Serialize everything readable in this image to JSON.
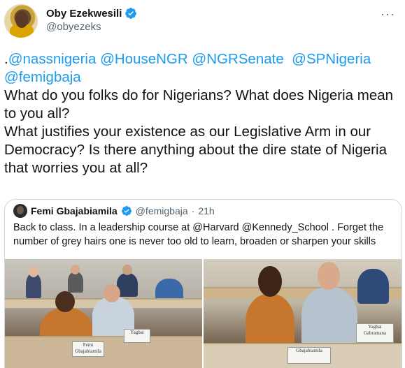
{
  "tweet": {
    "author_name": "Oby Ezekwesili",
    "author_handle": "@obyezeks",
    "more_icon": "···",
    "text_lines": [
      [
        ".",
        "@nassnigeria",
        " ",
        "@HouseNGR",
        " ",
        "@NGRSenate",
        "  ",
        "@SPNigeria"
      ],
      [
        "@femigbaja"
      ]
    ],
    "mentions": [
      "@nassnigeria",
      "@HouseNGR",
      "@NGRSenate",
      "@SPNigeria",
      "@femigbaja"
    ],
    "body_1": "What do you folks do for Nigerians? What does Nigeria mean to you all?",
    "body_2": "What justifies your existence as our Legislative Arm in our Democracy? Is there anything about the dire state of Nigeria that worries you at all?"
  },
  "quote": {
    "author_name": "Femi Gbajabiamila",
    "author_handle": "@femigbaja",
    "separator": "·",
    "time": "21h",
    "text": "Back to class. In a leadership course at @Harvard @Kennedy_School . Forget the number of grey hairs one is never too old to learn, broaden or sharpen your skills",
    "photo_nameplates": [
      "Femi Gbajabiamila",
      "Yagbai",
      "Gbajabiamila",
      "Yagbai Gabramana"
    ]
  },
  "colors": {
    "accent": "#1d9bf0",
    "text": "#0f1419",
    "secondary": "#536471",
    "border": "#cfd9de"
  }
}
